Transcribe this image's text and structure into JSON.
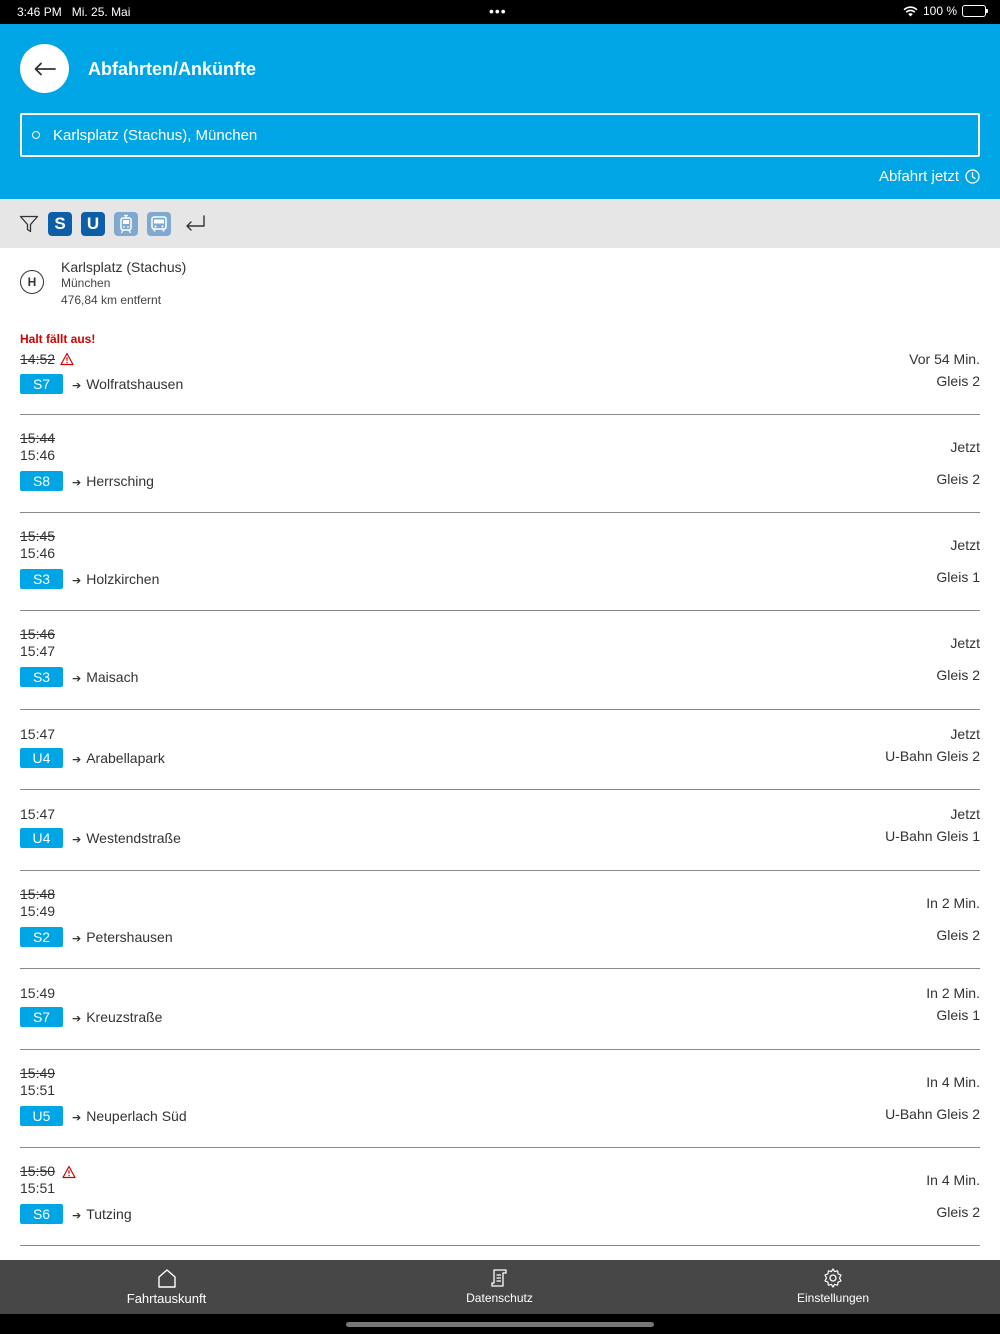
{
  "status": {
    "time": "3:46 PM",
    "date": "Mi. 25. Mai",
    "battery": "100 %"
  },
  "header": {
    "title": "Abfahrten/Ankünfte",
    "search_value": "Karlsplatz (Stachus), München",
    "departure_label": "Abfahrt jetzt"
  },
  "filters": {
    "s_label": "S",
    "u_label": "U"
  },
  "station": {
    "name": "Karlsplatz (Stachus)",
    "city": "München",
    "distance": "476,84 km entfernt",
    "icon_letter": "H"
  },
  "departures": [
    {
      "alert": "Halt fällt aus!",
      "planned": "14:52",
      "actual": "",
      "warning": true,
      "line": "S7",
      "destination": "Wolfratshausen",
      "relative": "Vor 54 Min.",
      "platform": "Gleis 2"
    },
    {
      "alert": "",
      "planned": "15:44",
      "actual": "15:46",
      "warning": false,
      "line": "S8",
      "destination": "Herrsching",
      "relative": "Jetzt",
      "platform": "Gleis 2"
    },
    {
      "alert": "",
      "planned": "15:45",
      "actual": "15:46",
      "warning": false,
      "line": "S3",
      "destination": "Holzkirchen",
      "relative": "Jetzt",
      "platform": "Gleis 1"
    },
    {
      "alert": "",
      "planned": "15:46",
      "actual": "15:47",
      "warning": false,
      "line": "S3",
      "destination": "Maisach",
      "relative": "Jetzt",
      "platform": "Gleis 2"
    },
    {
      "alert": "",
      "planned": "15:47",
      "actual": "",
      "warning": false,
      "line": "U4",
      "destination": "Arabellapark",
      "relative": "Jetzt",
      "platform": "U-Bahn Gleis 2"
    },
    {
      "alert": "",
      "planned": "15:47",
      "actual": "",
      "warning": false,
      "line": "U4",
      "destination": "Westendstraße",
      "relative": "Jetzt",
      "platform": "U-Bahn Gleis 1"
    },
    {
      "alert": "",
      "planned": "15:48",
      "actual": "15:49",
      "warning": false,
      "line": "S2",
      "destination": "Petershausen",
      "relative": "In 2 Min.",
      "platform": "Gleis 2"
    },
    {
      "alert": "",
      "planned": "15:49",
      "actual": "",
      "warning": false,
      "line": "S7",
      "destination": "Kreuzstraße",
      "relative": "In 2 Min.",
      "platform": "Gleis 1"
    },
    {
      "alert": "",
      "planned": "15:49",
      "actual": "15:51",
      "warning": false,
      "line": "U5",
      "destination": "Neuperlach Süd",
      "relative": "In 4 Min.",
      "platform": "U-Bahn Gleis 2"
    },
    {
      "alert": "",
      "planned": "15:50",
      "actual": "15:51",
      "warning": true,
      "line": "S6",
      "destination": "Tutzing",
      "relative": "In 4 Min.",
      "platform": "Gleis 2"
    }
  ],
  "tabs": [
    {
      "label": "Fahrtauskunft",
      "icon": "home-icon"
    },
    {
      "label": "Datenschutz",
      "icon": "document-icon"
    },
    {
      "label": "Einstellungen",
      "icon": "gear-icon"
    }
  ],
  "colors": {
    "brand": "#00a5e5",
    "alert": "#d40000",
    "tabbar": "#474747"
  }
}
